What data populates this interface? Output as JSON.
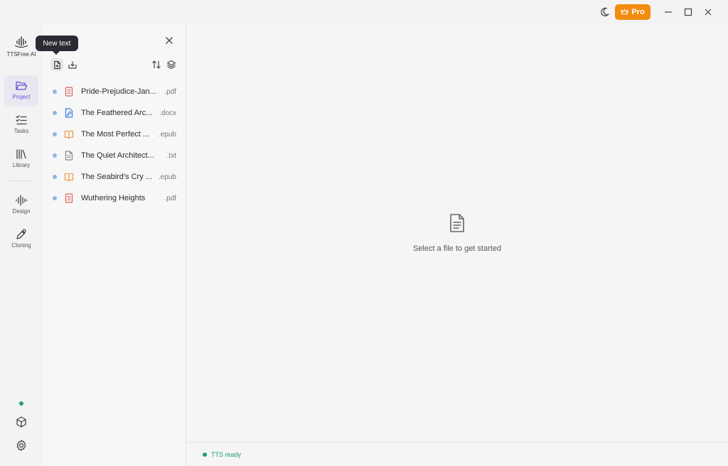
{
  "titlebar": {
    "pro_label": "Pro",
    "colors": {
      "pro": "#f28c0f"
    }
  },
  "rail": {
    "brand_name": "TTSFree AI",
    "items": [
      {
        "label": "Project",
        "icon": "folder-open-icon",
        "active": true
      },
      {
        "label": "Tasks",
        "icon": "checklist-icon"
      },
      {
        "label": "Library",
        "icon": "library-icon"
      },
      {
        "label": "Design",
        "icon": "waveform-icon"
      },
      {
        "label": "Cloning",
        "icon": "pen-icon"
      }
    ],
    "accent": "#6b4fd8"
  },
  "panel": {
    "tooltip": "New text",
    "files": [
      {
        "name": "Pride-Prejudice-Jan...",
        "ext": ".pdf",
        "icon": "pdf-file-icon",
        "color": "#e0625b"
      },
      {
        "name": "The Feathered Arc...",
        "ext": ".docx",
        "icon": "docx-file-icon",
        "color": "#3b7ddd"
      },
      {
        "name": "The Most Perfect ...",
        "ext": ".epub",
        "icon": "book-icon",
        "color": "#f0973a"
      },
      {
        "name": "The Quiet Architect...",
        "ext": ".txt",
        "icon": "txt-file-icon",
        "color": "#888888"
      },
      {
        "name": "The Seabird's Cry ...",
        "ext": ".epub",
        "icon": "book-icon",
        "color": "#f0973a"
      },
      {
        "name": "Wuthering Heights",
        "ext": ".pdf",
        "icon": "pdf-file-icon",
        "color": "#e0625b"
      }
    ]
  },
  "main": {
    "empty_text": "Select a file to get started"
  },
  "status": {
    "text": "TTS ready",
    "color": "#22a06b"
  }
}
